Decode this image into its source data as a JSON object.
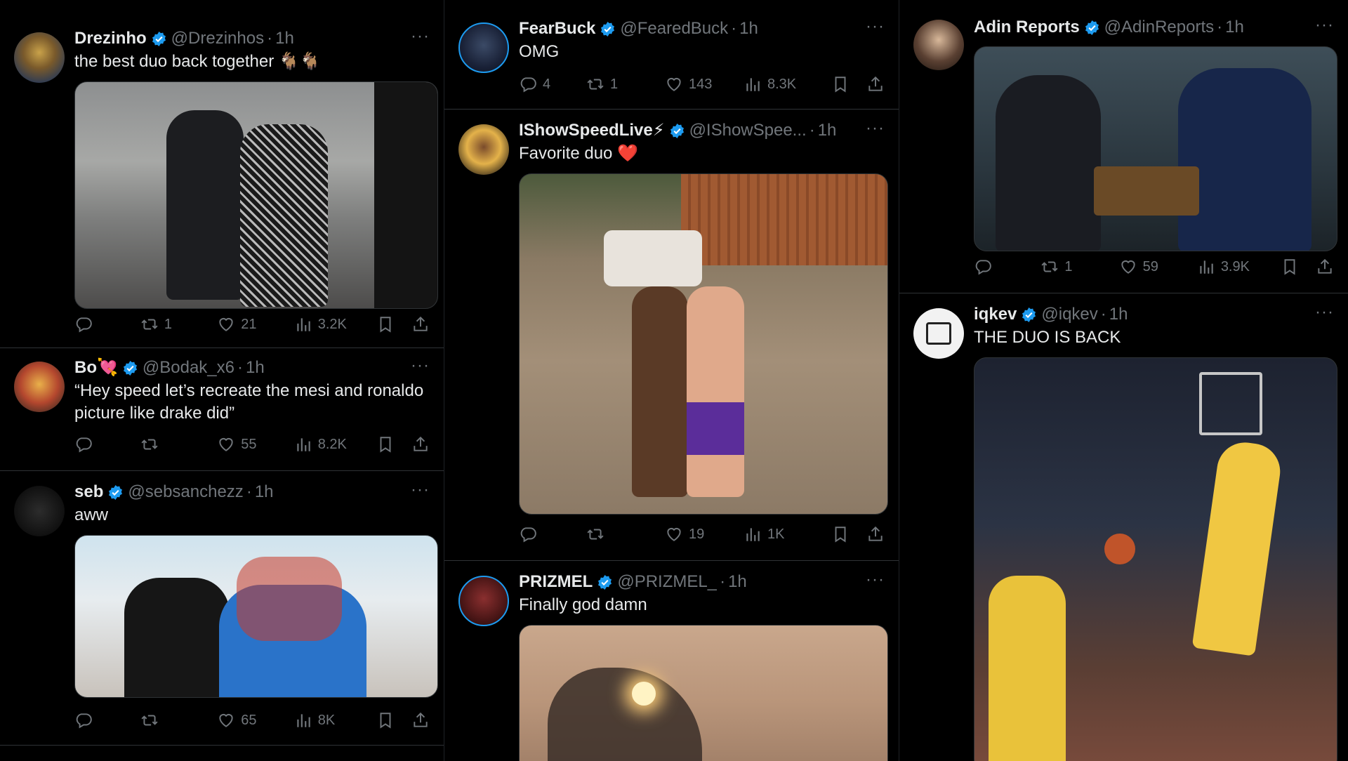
{
  "colors": {
    "background": "#000000",
    "text": "#e7e9ea",
    "muted": "#71767b",
    "verified": "#1d9bf0",
    "heart": "#f91880"
  },
  "icons": {
    "reply": "reply-icon",
    "retweet": "retweet-icon",
    "like": "heart-icon",
    "views": "views-icon",
    "bookmark": "bookmark-icon",
    "share": "share-icon",
    "more": "more-icon",
    "verified": "verified-badge-icon"
  },
  "tweets": [
    {
      "name": "Drezinho",
      "handle": "@Drezinhos",
      "time": "1h",
      "text": "the best duo back together 🐐🐐",
      "replies": "",
      "retweets": "1",
      "likes": "21",
      "views": "3.2K"
    },
    {
      "name": "Bo💘",
      "handle": "@Bodak_x6",
      "time": "1h",
      "text": "“Hey speed let’s recreate the mesi and ronaldo picture like drake did”",
      "replies": "",
      "retweets": "",
      "likes": "55",
      "views": "8.2K"
    },
    {
      "name": "seb",
      "handle": "@sebsanchezz",
      "time": "1h",
      "text": "aww",
      "replies": "",
      "retweets": "",
      "likes": "65",
      "views": "8K"
    },
    {
      "name": "FearBuck",
      "handle": "@FearedBuck",
      "time": "1h",
      "text": "OMG",
      "replies": "4",
      "retweets": "1",
      "likes": "143",
      "views": "8.3K"
    },
    {
      "name": "IShowSpeedLive⚡",
      "handle": "@IShowSpee...",
      "time": "1h",
      "text": "Favorite duo ❤️",
      "replies": "",
      "retweets": "",
      "likes": "19",
      "views": "1K"
    },
    {
      "name": "PRIZMEL",
      "handle": "@PRIZMEL_",
      "time": "1h",
      "text": "Finally god damn",
      "replies": "",
      "retweets": "",
      "likes": "",
      "views": ""
    },
    {
      "name": "Adin Reports",
      "handle": "@AdinReports",
      "time": "1h",
      "text": "",
      "replies": "",
      "retweets": "1",
      "likes": "59",
      "views": "3.9K"
    },
    {
      "name": "iqkev",
      "handle": "@iqkev",
      "time": "1h",
      "text": "THE DUO IS BACK",
      "replies": "",
      "retweets": "",
      "likes": "",
      "views": ""
    }
  ],
  "more_label": "···",
  "dot": "·"
}
